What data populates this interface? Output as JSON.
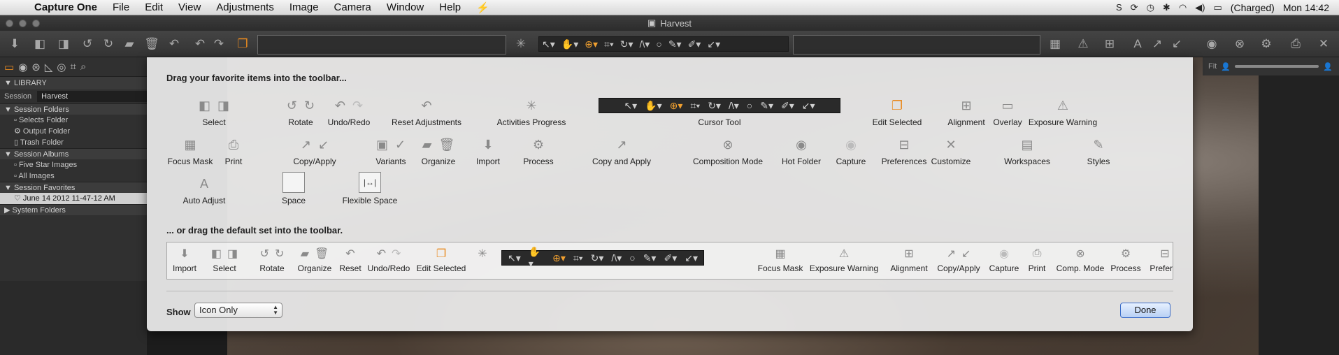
{
  "menubar": {
    "app": "Capture One",
    "items": [
      "File",
      "Edit",
      "View",
      "Adjustments",
      "Image",
      "Camera",
      "Window",
      "Help"
    ],
    "battery": "(Charged)",
    "clock": "Mon 14:42"
  },
  "window": {
    "title": "Harvest"
  },
  "library": {
    "header": "LIBRARY",
    "session_label": "Session",
    "session_value": "Harvest",
    "groups": [
      {
        "title": "Session Folders",
        "items": [
          "Selects Folder",
          "Output Folder",
          "Trash Folder"
        ]
      },
      {
        "title": "Session Albums",
        "items": [
          "Five Star Images",
          "All Images"
        ]
      },
      {
        "title": "Session Favorites",
        "items": [
          "June 14 2012 11-47-12 AM"
        ]
      },
      {
        "title": "System Folders",
        "items": []
      }
    ]
  },
  "viewer": {
    "fit_label": "Fit"
  },
  "sheet": {
    "heading1": "Drag your favorite items into the toolbar...",
    "heading2": "... or drag the default set into the toolbar.",
    "row1": [
      "Select",
      "Rotate",
      "Undo/Redo",
      "Reset Adjustments",
      "Activities Progress",
      "Cursor Tool",
      "Edit Selected",
      "Alignment",
      "Overlay",
      "Exposure Warning"
    ],
    "row2": [
      "Focus Mask",
      "Print",
      "Copy/Apply",
      "Variants",
      "Organize",
      "Import",
      "Process",
      "Copy and Apply",
      "Composition Mode",
      "Hot Folder",
      "Capture",
      "Preferences",
      "Customize",
      "Workspaces",
      "Styles"
    ],
    "row3": [
      "Auto Adjust",
      "Space",
      "Flexible Space"
    ],
    "default_set": [
      "Import",
      "Select",
      "Rotate",
      "Organize",
      "Reset",
      "Undo/Redo",
      "Edit Selected",
      "Focus Mask",
      "Exposure Warning",
      "Alignment",
      "Copy/Apply",
      "Capture",
      "Print",
      "Comp. Mode",
      "Process",
      "Preferer"
    ],
    "show_label": "Show",
    "show_value": "Icon Only",
    "done_label": "Done"
  },
  "colors": {
    "accent_orange": "#e88a20",
    "done_blue": "#3a6cc8"
  }
}
